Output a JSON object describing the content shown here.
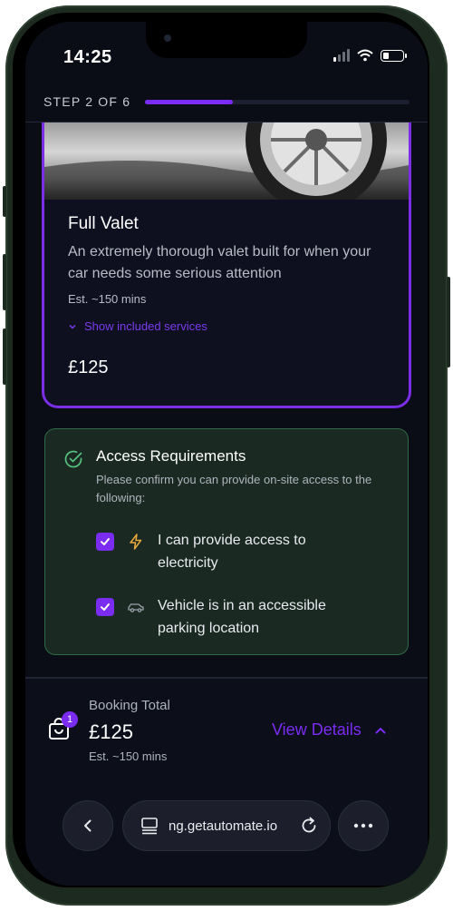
{
  "status_bar": {
    "time": "14:25"
  },
  "step": {
    "label": "STEP 2 OF 6",
    "current": 2,
    "total": 6
  },
  "service": {
    "title": "Full Valet",
    "description": "An extremely thorough valet built for when your car needs some serious attention",
    "duration": "Est. ~150 mins",
    "toggle_label": "Show included services",
    "price": "£125"
  },
  "access": {
    "title": "Access Requirements",
    "subtitle": "Please confirm you can provide on-site access to the following:",
    "items": [
      {
        "label": "I can provide access to electricity",
        "icon": "lightning-icon",
        "checked": true
      },
      {
        "label": "Vehicle is in an accessible parking location",
        "icon": "car-icon",
        "checked": true
      }
    ]
  },
  "booking": {
    "label": "Booking Total",
    "total": "£125",
    "duration": "Est. ~150 mins",
    "cart_count": "1",
    "view_details": "View Details"
  },
  "browser": {
    "url": "ng.getautomate.io"
  },
  "colors": {
    "accent": "#7b2cf2",
    "success_border": "#2e6a45",
    "background": "#0b0d16"
  }
}
